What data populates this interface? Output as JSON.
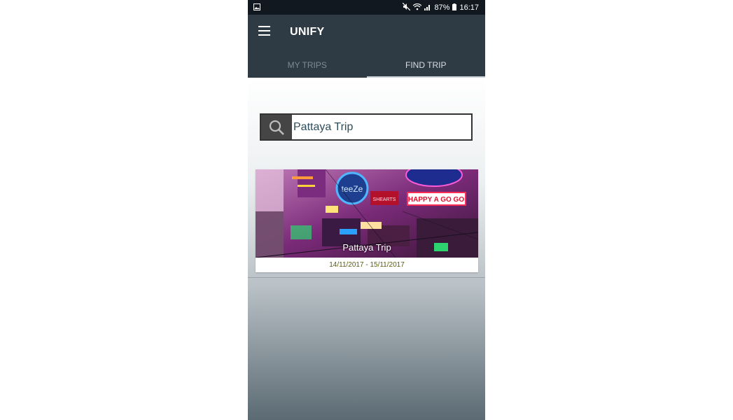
{
  "status_bar": {
    "battery": "87%",
    "time": "16:17"
  },
  "app_bar": {
    "title": "UNIFY"
  },
  "tabs": [
    {
      "label": "MY TRIPS",
      "active": false
    },
    {
      "label": "FIND TRIP",
      "active": true
    }
  ],
  "search": {
    "value": "Pattaya Trip"
  },
  "results": [
    {
      "title": "Pattaya Trip",
      "dates": "14/11/2017 - 15/11/2017",
      "sign_texts": [
        "HAPPY A GO GO"
      ]
    }
  ],
  "colors": {
    "app_bar": "#2f3b44",
    "status_bar": "#111820",
    "tab_active": "#d6dde2",
    "tab_inactive": "#7d8993"
  }
}
